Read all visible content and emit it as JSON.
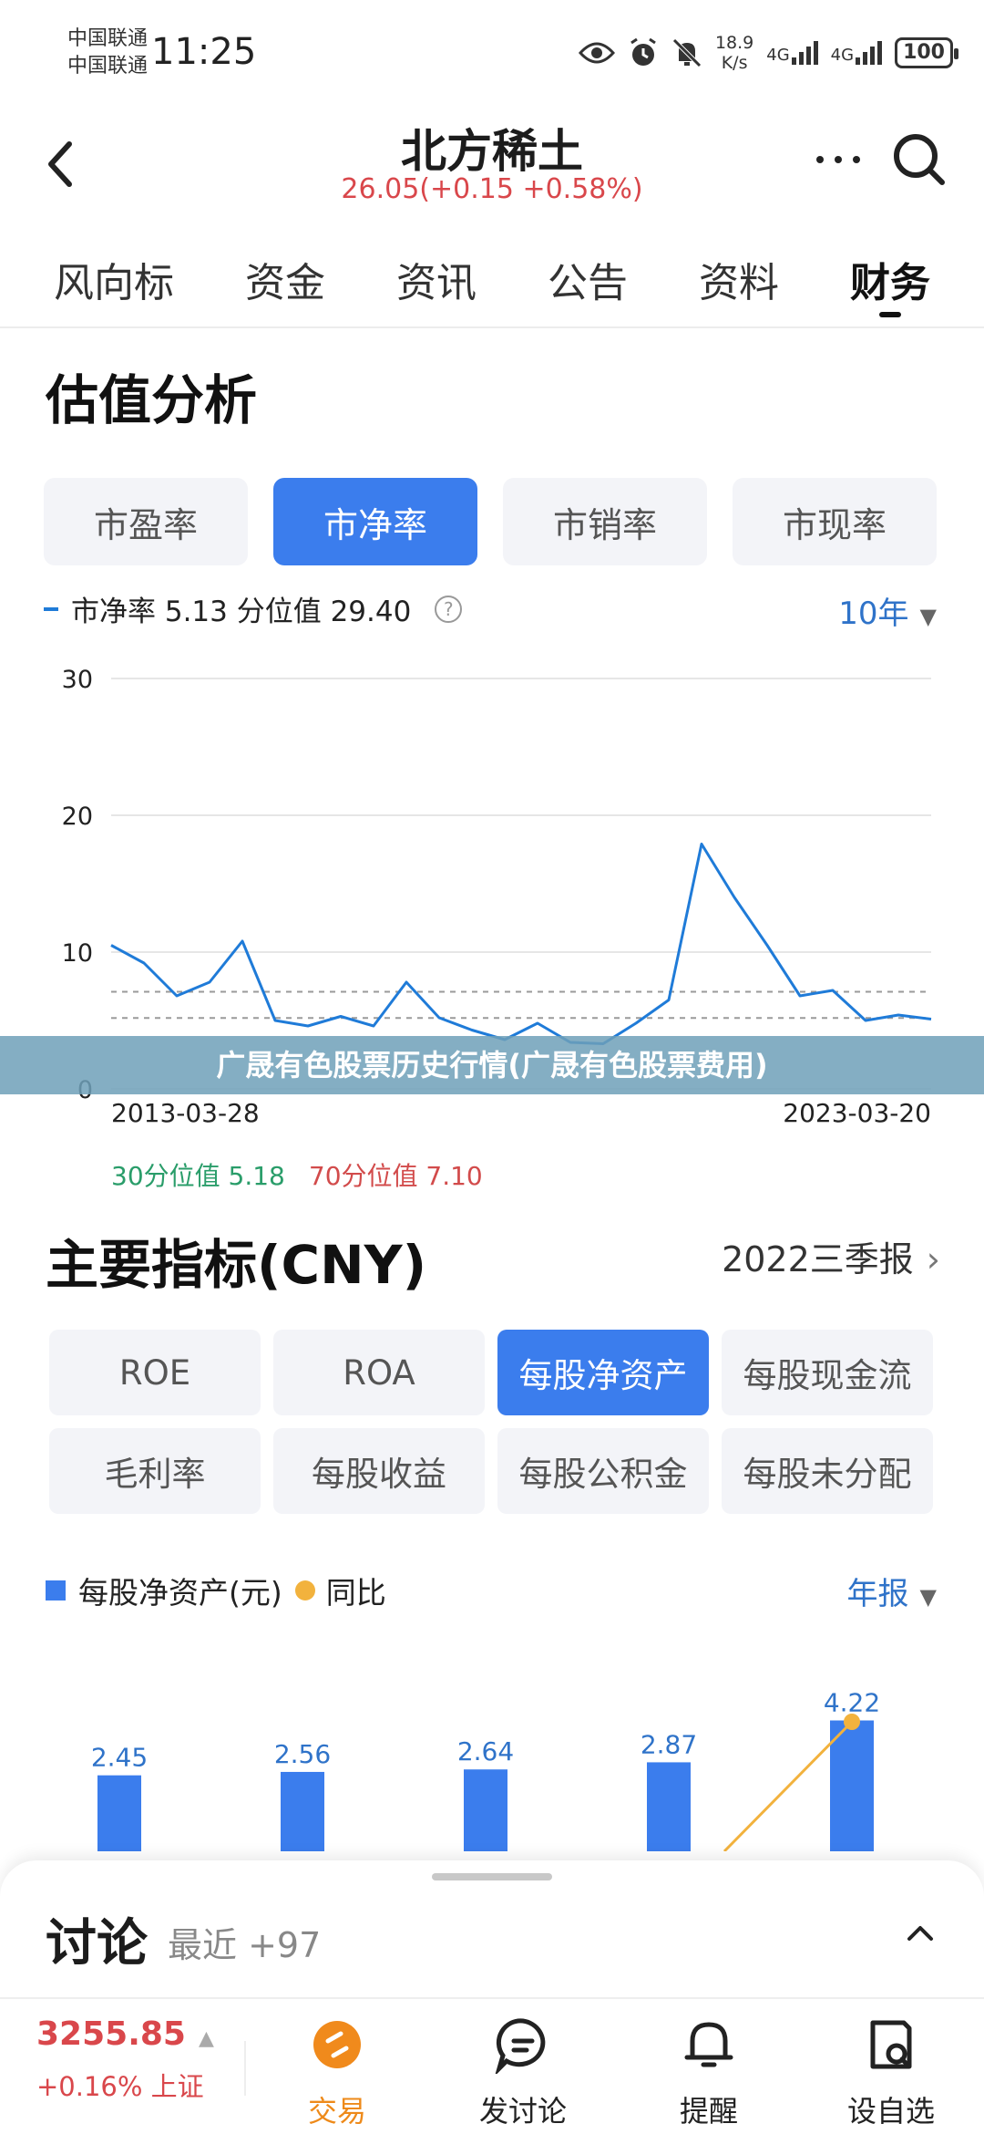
{
  "status_bar": {
    "carrier_1": "中国联通",
    "carrier_2": "中国联通",
    "time": "11:25",
    "net_speed_value": "18.9",
    "net_speed_unit": "K/s",
    "signal_1": "4G",
    "signal_2": "4G",
    "battery": "100"
  },
  "header": {
    "title": "北方稀土",
    "price_line": "26.05(+0.15 +0.58%)",
    "price_color": "#d9474b"
  },
  "tabs": [
    "风向标",
    "资金",
    "资讯",
    "公告",
    "资料",
    "财务"
  ],
  "active_tab": "财务",
  "valuation": {
    "title": "估值分析",
    "pills": [
      "市盈率",
      "市净率",
      "市销率",
      "市现率"
    ],
    "active_pill": "市净率",
    "legend": "市净率 5.13  分位值 29.40",
    "range": "10年",
    "percentile_30": "30分位值 5.18",
    "percentile_70": "70分位值 7.10"
  },
  "banner": "广晟有色股票历史行情(广晟有色股票费用)",
  "indicators": {
    "title": "主要指标(CNY)",
    "period": "2022三季报",
    "items": [
      "ROE",
      "ROA",
      "每股净资产",
      "每股现金流",
      "毛利率",
      "每股收益",
      "每股公积金",
      "每股未分配"
    ],
    "active": "每股净资产",
    "legend_bar": "每股净资产(元)",
    "legend_dot": "同比",
    "report_select": "年报"
  },
  "chart_data": [
    {
      "type": "line",
      "series": [
        {
          "name": "市净率",
          "color": "#1f7bd8"
        }
      ],
      "x": [
        "2013-03-28",
        "2013-08",
        "2014-02",
        "2014-08",
        "2015-02",
        "2015-06",
        "2015-08",
        "2016-02",
        "2016-08",
        "2017-02",
        "2017-08",
        "2018-02",
        "2018-08",
        "2019-02",
        "2019-08",
        "2020-02",
        "2020-08",
        "2021-02",
        "2021-06",
        "2021-09",
        "2021-12",
        "2022-03",
        "2022-06",
        "2022-09",
        "2022-12",
        "2023-03-20"
      ],
      "y": [
        10.5,
        9.2,
        6.8,
        7.8,
        10.8,
        5.0,
        4.6,
        5.3,
        4.6,
        7.8,
        5.2,
        4.3,
        3.6,
        4.8,
        3.4,
        3.3,
        4.8,
        6.5,
        17.9,
        14.0,
        10.5,
        6.8,
        7.2,
        5.0,
        5.4,
        5.1
      ],
      "x_tick_labels": [
        "2013-03-28",
        "2023-03-20"
      ],
      "ylim": [
        0,
        30
      ],
      "y_ticks": [
        0,
        10,
        20,
        30
      ],
      "reference_lines": [
        5.18,
        7.1
      ],
      "grid": true
    },
    {
      "type": "bar",
      "categories": [
        "",
        "",
        "",
        "",
        ""
      ],
      "series": [
        {
          "name": "每股净资产(元)",
          "color": "#3b7ded",
          "values": [
            2.45,
            2.56,
            2.64,
            2.87,
            4.22
          ]
        },
        {
          "name": "同比",
          "color": "#f2b23d"
        }
      ],
      "data_labels": [
        "2.45",
        "2.56",
        "2.64",
        "2.87",
        "4.22"
      ]
    }
  ],
  "discussion": {
    "title": "讨论",
    "subtitle": "最近 +97"
  },
  "bottom_nav": {
    "index_value": "3255.85",
    "index_change": "+0.16% 上证",
    "items": [
      "交易",
      "发讨论",
      "提醒",
      "设自选"
    ]
  }
}
